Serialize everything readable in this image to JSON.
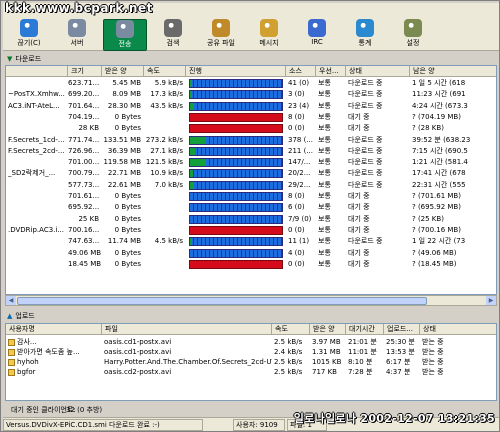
{
  "watermark": "kkk.www.bcpark.net",
  "toolbar": {
    "buttons": [
      {
        "label": "끊기(C)",
        "icon": "disconnect-icon",
        "color": "#2b7bd6"
      },
      {
        "label": "서버",
        "icon": "server-icon",
        "color": "#7a8aa0"
      },
      {
        "label": "전송",
        "icon": "transfer-icon",
        "color": "#7a8aa0"
      },
      {
        "label": "검색",
        "icon": "search-icon",
        "color": "#6a6a6a"
      },
      {
        "label": "공유 파일",
        "icon": "shared-files-icon",
        "color": "#c08a2a"
      },
      {
        "label": "메시지",
        "icon": "message-icon",
        "color": "#d0a030"
      },
      {
        "label": "IRC",
        "icon": "irc-icon",
        "color": "#3a6ad0"
      },
      {
        "label": "통계",
        "icon": "statistics-icon",
        "color": "#2a8ad0"
      },
      {
        "label": "설정",
        "icon": "settings-icon",
        "color": "#7a8a50"
      }
    ]
  },
  "downloads": {
    "title": "다운로드",
    "columns": [
      "",
      "크기",
      "받은 양",
      "속도",
      "진행",
      "소스",
      "우선...",
      "상태",
      "남은 양"
    ],
    "rows": [
      {
        "name": "",
        "size": "623.71...",
        "recv": "5.45 MB",
        "speed": "5.9 kB/s",
        "progress": 0.01,
        "red": false,
        "sources": "41 (0)",
        "priority": "보통",
        "status": "다운로드 중",
        "remain": "1 일 5 시간 (618"
      },
      {
        "name": "~PosTX.Xmhw...",
        "size": "699.20...",
        "recv": "8.09 MB",
        "speed": "17.3 kB/s",
        "progress": 0.01,
        "red": false,
        "sources": "3 (0)",
        "priority": "보통",
        "status": "다운로드 중",
        "remain": "11:23 시간 (691"
      },
      {
        "name": "AC3.iNT-AteL...",
        "size": "701.64...",
        "recv": "28.30 MB",
        "speed": "43.5 kB/s",
        "progress": 0.04,
        "red": false,
        "sources": "23 (4)",
        "priority": "보통",
        "status": "다운로드 중",
        "remain": "4:24 시간 (673.3"
      },
      {
        "name": "",
        "size": "704.19...",
        "recv": "0 Bytes",
        "speed": "",
        "progress": 0,
        "red": true,
        "sources": "8 (0)",
        "priority": "보통",
        "status": "대기 중",
        "remain": "? (704.19 MB)"
      },
      {
        "name": "",
        "size": "28 KB",
        "recv": "0 Bytes",
        "speed": "",
        "progress": 0,
        "red": true,
        "sources": "0 (0)",
        "priority": "보통",
        "status": "대기 중",
        "remain": "? (28 KB)"
      },
      {
        "name": "F.Secrets_1cd-...",
        "size": "771.74...",
        "recv": "133.51 MB",
        "speed": "273.2 kB/s",
        "progress": 0.17,
        "red": false,
        "sources": "378 (...",
        "priority": "보통",
        "status": "다운로드 중",
        "remain": "39:52 분 (638.23"
      },
      {
        "name": "F.Secrets_2cd-...",
        "size": "726.96...",
        "recv": "36.39 MB",
        "speed": "27.1 kB/s",
        "progress": 0.05,
        "red": false,
        "sources": "211 (...",
        "priority": "보통",
        "status": "다운로드 중",
        "remain": "7:15 시간 (690.5"
      },
      {
        "name": "",
        "size": "701.00...",
        "recv": "119.58 MB",
        "speed": "121.5 kB/s",
        "progress": 0.17,
        "red": false,
        "sources": "147/...",
        "priority": "보통",
        "status": "다운로드 중",
        "remain": "1:21 시간 (581.4"
      },
      {
        "name": "_SD2락제거_...",
        "size": "700.79...",
        "recv": "22.71 MB",
        "speed": "10.9 kB/s",
        "progress": 0.03,
        "red": false,
        "sources": "20/2...",
        "priority": "보통",
        "status": "다운로드 중",
        "remain": "17:41 시간 (678"
      },
      {
        "name": "",
        "size": "577.73...",
        "recv": "22.61 MB",
        "speed": "7.0 kB/s",
        "progress": 0.04,
        "red": false,
        "sources": "29/2...",
        "priority": "보통",
        "status": "다운로드 중",
        "remain": "22:31 시간 (555"
      },
      {
        "name": "",
        "size": "701.61...",
        "recv": "0 Bytes",
        "speed": "",
        "progress": 0,
        "red": false,
        "sources": "8 (0)",
        "priority": "보통",
        "status": "대기 중",
        "remain": "? (701.61 MB)"
      },
      {
        "name": "",
        "size": "695.92...",
        "recv": "0 Bytes",
        "speed": "",
        "progress": 0,
        "red": false,
        "sources": "6 (0)",
        "priority": "보통",
        "status": "대기 중",
        "remain": "? (695.92 MB)"
      },
      {
        "name": "",
        "size": "25 KB",
        "recv": "0 Bytes",
        "speed": "",
        "progress": 0,
        "red": false,
        "sources": "7/9 (0)",
        "priority": "보통",
        "status": "대기 중",
        "remain": "? (25 KB)"
      },
      {
        "name": ".DVDRip.AC3.i...",
        "size": "700.16...",
        "recv": "0 Bytes",
        "speed": "",
        "progress": 0,
        "red": true,
        "sources": "0 (0)",
        "priority": "보통",
        "status": "대기 중",
        "remain": "? (700.16 MB)"
      },
      {
        "name": "",
        "size": "747.63...",
        "recv": "11.74 MB",
        "speed": "4.5 kB/s",
        "progress": 0.02,
        "red": false,
        "sources": "11 (1)",
        "priority": "보통",
        "status": "다운로드 중",
        "remain": "1 일 22 시간 (73"
      },
      {
        "name": "",
        "size": "49.06 MB",
        "recv": "0 Bytes",
        "speed": "",
        "progress": 0,
        "red": false,
        "sources": "4 (0)",
        "priority": "보통",
        "status": "대기 중",
        "remain": "? (49.06 MB)"
      },
      {
        "name": "",
        "size": "18.45 MB",
        "recv": "0 Bytes",
        "speed": "",
        "progress": 0,
        "red": true,
        "sources": "0 (0)",
        "priority": "보통",
        "status": "대기 중",
        "remain": "? (18.45 MB)"
      }
    ]
  },
  "uploads": {
    "title": "업로드",
    "columns": [
      "사용자명",
      "파일",
      "속도",
      "받은 양",
      "대기시간",
      "업로드...",
      "상태"
    ],
    "rows": [
      {
        "user": "감사...",
        "file": "oasis.cd1-postx.avi",
        "speed": "2.5 kB/s",
        "recv": "3.97 MB",
        "wait": "21:01 분",
        "upload": "25:30 분",
        "status": "받는 중"
      },
      {
        "user": "받아가면 속도좀 높...",
        "file": "oasis.cd1-postx.avi",
        "speed": "2.4 kB/s",
        "recv": "1.31 MB",
        "wait": "11:01 분",
        "upload": "13:53 분",
        "status": "받는 중"
      },
      {
        "user": "hyhoh",
        "file": "Harry.Potter.And.The.Chamber.Of.Secrets_2cd-UTi...",
        "speed": "2.5 kB/s",
        "recv": "1015 KB",
        "wait": "8:10 분",
        "upload": "6:17 분",
        "status": "받는 중"
      },
      {
        "user": "bgfor",
        "file": "oasis.cd2-postx.avi",
        "speed": "2.5 kB/s",
        "recv": "717 KB",
        "wait": "7:28 분",
        "upload": "4:37 분",
        "status": "받는 중"
      }
    ]
  },
  "pending": {
    "label": "대기 중인 클라이언트:",
    "value": "32 (0 추방)"
  },
  "statusbar": {
    "message": "Versus.DVDivX-EPiC.CD1.smi 다운로드 완료 :-)",
    "users": "사용자: 9109",
    "files": "파일: 1",
    "stamp": "일로나일로나 2002-12-07 13:21:35"
  }
}
